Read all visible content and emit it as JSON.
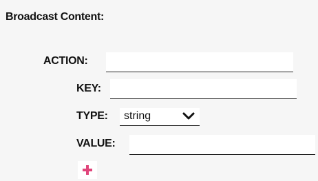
{
  "broadcast": {
    "heading": "Broadcast Content:",
    "action_label": "ACTION:",
    "action_value": "",
    "key_label": "KEY:",
    "key_value": "",
    "type_label": "TYPE:",
    "type_selected": "string",
    "value_label": "VALUE:",
    "value_value": "",
    "add_icon": "plus-icon",
    "add_color": "#e0457b"
  }
}
